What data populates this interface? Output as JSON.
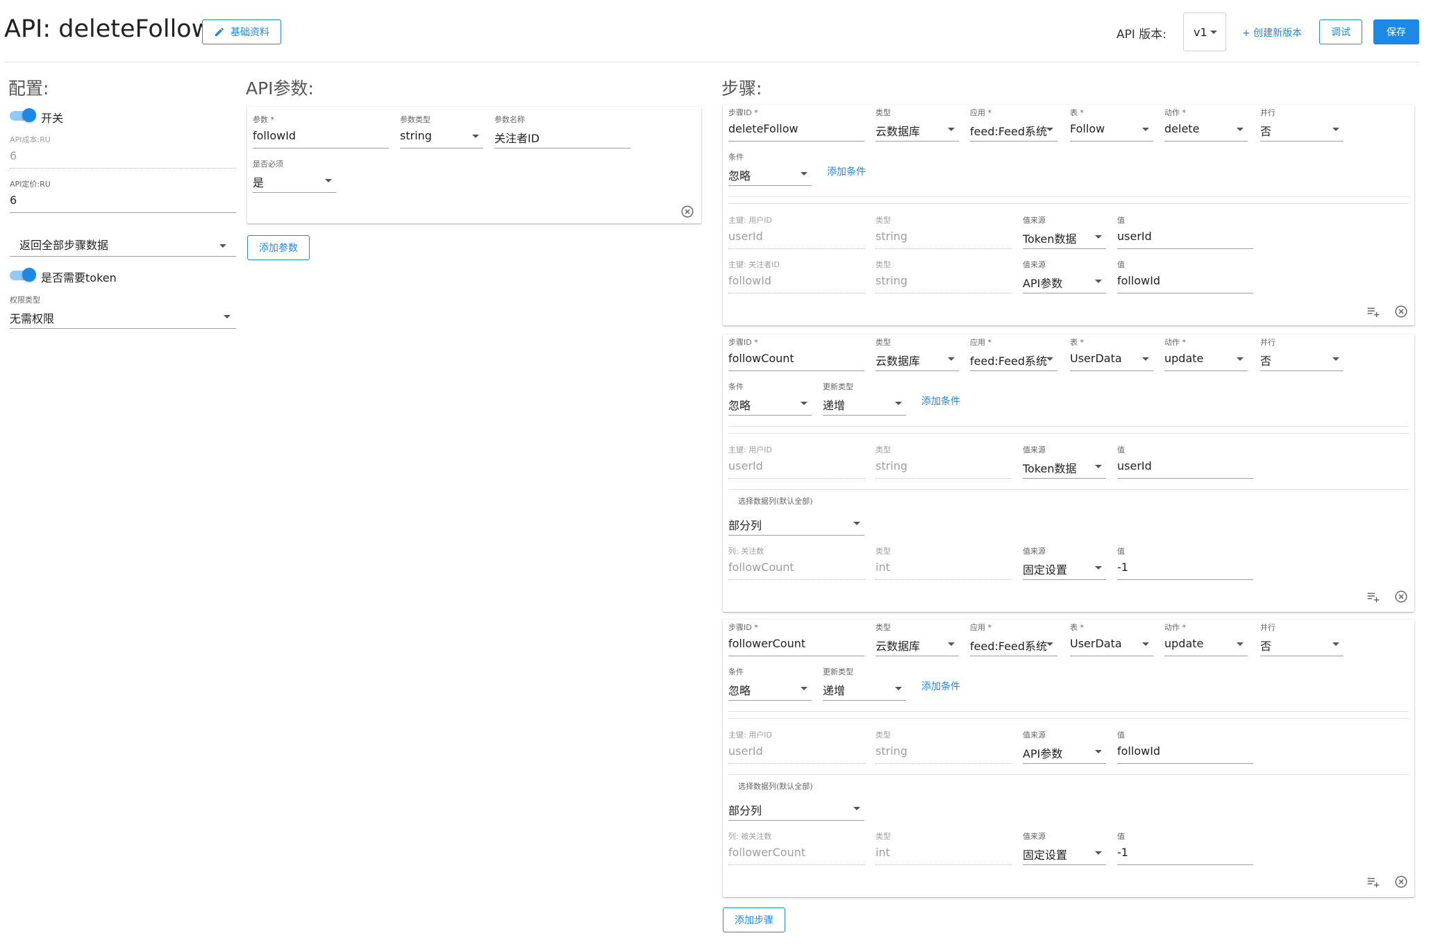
{
  "header": {
    "title": "API: deleteFollow",
    "basic_info_label": "基础资料",
    "version_label": "API 版本:",
    "version_value": "v1",
    "new_version_label": "+ 创建新版本",
    "debug_label": "调试",
    "save_label": "保存"
  },
  "config": {
    "title": "配置:",
    "switch_label": "开关",
    "cost_label": "API成本:RU",
    "cost_value": "6",
    "price_label": "API定价:RU",
    "price_value": "6",
    "return_mode": "返回全部步骤数据",
    "token_label": "是否需要token",
    "perm_label": "权限类型",
    "perm_value": "无需权限"
  },
  "params": {
    "title": "API参数:",
    "name_label": "参数 *",
    "name_value": "followId",
    "type_label": "参数类型",
    "type_value": "string",
    "display_label": "参数名称",
    "display_value": "关注者ID",
    "required_label": "是否必须",
    "required_value": "是",
    "add_label": "添加参数"
  },
  "steps_title": "步骤:",
  "add_step_label": "添加步骤",
  "steps": [
    {
      "id_label": "步骤ID *",
      "id": "deleteFollow",
      "type_label": "类型",
      "type": "云数据库",
      "app_label": "应用 *",
      "app": "feed:Feed系统",
      "table_label": "表 *",
      "table": "Follow",
      "action_label": "动作 *",
      "action": "delete",
      "parallel_label": "并行",
      "parallel": "否",
      "cond_label": "条件",
      "cond": "忽略",
      "add_cond": "添加条件",
      "keys": [
        {
          "key_label": "主键: 用户ID",
          "key": "userId",
          "type_label": "类型",
          "type": "string",
          "src_label": "值来源",
          "src": "Token数据",
          "val_label": "值",
          "val": "userId"
        },
        {
          "key_label": "主键: 关注者ID",
          "key": "followId",
          "type_label": "类型",
          "type": "string",
          "src_label": "值来源",
          "src": "API参数",
          "val_label": "值",
          "val": "followId"
        }
      ]
    },
    {
      "id_label": "步骤ID *",
      "id": "followCount",
      "type_label": "类型",
      "type": "云数据库",
      "app_label": "应用 *",
      "app": "feed:Feed系统",
      "table_label": "表 *",
      "table": "UserData",
      "action_label": "动作 *",
      "action": "update",
      "parallel_label": "并行",
      "parallel": "否",
      "cond_label": "条件",
      "cond": "忽略",
      "update_label": "更新类型",
      "update": "递增",
      "add_cond": "添加条件",
      "keys": [
        {
          "key_label": "主键: 用户ID",
          "key": "userId",
          "type_label": "类型",
          "type": "string",
          "src_label": "值来源",
          "src": "Token数据",
          "val_label": "值",
          "val": "userId"
        }
      ],
      "cols_label": "选择数据列(默认全部)",
      "cols": "部分列",
      "column": {
        "col_label": "列: 关注数",
        "col": "followCount",
        "type_label": "类型",
        "type": "int",
        "src_label": "值来源",
        "src": "固定设置",
        "val_label": "值",
        "val": "-1"
      }
    },
    {
      "id_label": "步骤ID *",
      "id": "followerCount",
      "type_label": "类型",
      "type": "云数据库",
      "app_label": "应用 *",
      "app": "feed:Feed系统",
      "table_label": "表 *",
      "table": "UserData",
      "action_label": "动作 *",
      "action": "update",
      "parallel_label": "并行",
      "parallel": "否",
      "cond_label": "条件",
      "cond": "忽略",
      "update_label": "更新类型",
      "update": "递增",
      "add_cond": "添加条件",
      "keys": [
        {
          "key_label": "主键: 用户ID",
          "key": "userId",
          "type_label": "类型",
          "type": "string",
          "src_label": "值来源",
          "src": "API参数",
          "val_label": "值",
          "val": "followId"
        }
      ],
      "cols_label": "选择数据列(默认全部)",
      "cols": "部分列",
      "column": {
        "col_label": "列: 被关注数",
        "col": "followerCount",
        "type_label": "类型",
        "type": "int",
        "src_label": "值来源",
        "src": "固定设置",
        "val_label": "值",
        "val": "-1"
      }
    }
  ]
}
